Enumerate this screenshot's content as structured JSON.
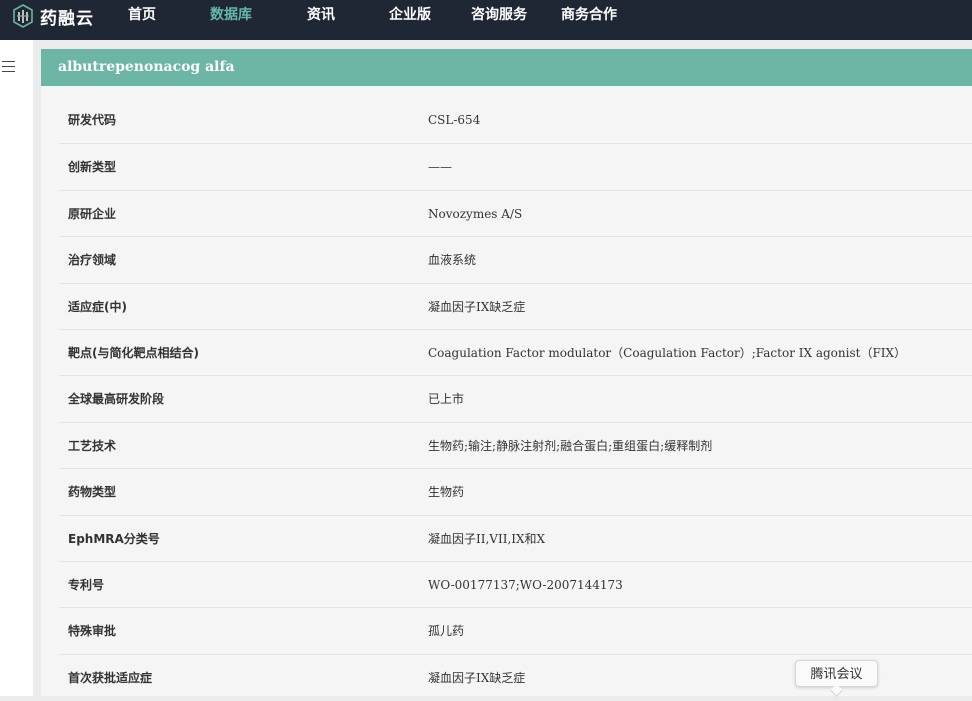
{
  "brand": {
    "name": "药融云",
    "logo_icon": "cube-logo-icon",
    "accent": "#6db5a4",
    "nav_bg": "#1f2634"
  },
  "nav": {
    "items": [
      {
        "label": "首页"
      },
      {
        "label": "数据库",
        "active": true
      },
      {
        "label": "资讯"
      },
      {
        "label": "企业版"
      },
      {
        "label": "咨询服务"
      },
      {
        "label": "商务合作"
      }
    ]
  },
  "sidebar": {
    "menu_icon": "hamburger-menu-icon"
  },
  "drug": {
    "title": "albutrepenonacog alfa",
    "fields": [
      {
        "label": "研发代码",
        "value": "CSL-654"
      },
      {
        "label": "创新类型",
        "value": "——"
      },
      {
        "label": "原研企业",
        "value": "Novozymes A/S"
      },
      {
        "label": "治疗领域",
        "value": "血液系统"
      },
      {
        "label": "适应症(中)",
        "value": "凝血因子IX缺乏症"
      },
      {
        "label": "靶点(与简化靶点相结合)",
        "value": "Coagulation Factor modulator（Coagulation Factor）;Factor IX agonist（FIX）"
      },
      {
        "label": "全球最高研发阶段",
        "value": "已上市"
      },
      {
        "label": "工艺技术",
        "value": "生物药;输注;静脉注射剂;融合蛋白;重组蛋白;缓释制剂"
      },
      {
        "label": "药物类型",
        "value": "生物药"
      },
      {
        "label": "EphMRA分类号",
        "value": "凝血因子II,VII,IX和X"
      },
      {
        "label": "专利号",
        "value": "WO-00177137;WO-2007144173"
      },
      {
        "label": "特殊审批",
        "value": "孤儿药"
      },
      {
        "label": "首次获批适应症",
        "value": "凝血因子IX缺乏症"
      }
    ]
  },
  "tooltip": {
    "text": "腾讯会议"
  }
}
